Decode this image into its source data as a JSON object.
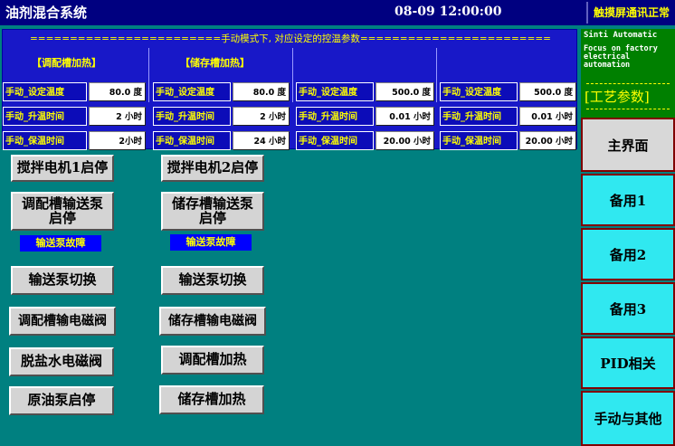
{
  "header": {
    "title": "油剂混合系统",
    "datetime": "08-09 12:00:00",
    "comm_status": "触摸屏通讯正常"
  },
  "params": {
    "banner": "========================手动模式下, 对应设定的控温参数========================",
    "groups": [
      {
        "title": "【调配槽加热】",
        "rows": [
          {
            "label": "手动_设定温度",
            "value": "80.0 度"
          },
          {
            "label": "手动_升温时间",
            "value": "2 小时"
          },
          {
            "label": "手动_保温时间",
            "value": "2小时"
          }
        ]
      },
      {
        "title": "【储存槽加热】",
        "rows": [
          {
            "label": "手动_设定温度",
            "value": "80.0 度"
          },
          {
            "label": "手动_升温时间",
            "value": "2 小时"
          },
          {
            "label": "手动_保温时间",
            "value": "24 小时"
          }
        ]
      },
      {
        "title": "",
        "rows": [
          {
            "label": "手动_设定温度",
            "value": "500.0 度"
          },
          {
            "label": "手动_升温时间",
            "value": "0.01 小时"
          },
          {
            "label": "手动_保温时间",
            "value": "20.00 小时"
          }
        ]
      },
      {
        "title": "",
        "rows": [
          {
            "label": "手动_设定温度",
            "value": "500.0 度"
          },
          {
            "label": "手动_升温时间",
            "value": "0.01 小时"
          },
          {
            "label": "手动_保温时间",
            "value": "20.00 小时"
          }
        ]
      }
    ]
  },
  "controls": {
    "col1": {
      "stirrer": "搅拌电机1启停",
      "pump": "调配槽输送泵启停",
      "fault": "输送泵故障",
      "switch": "输送泵切换",
      "valve": "调配槽输电磁阀",
      "water_valve": "脱盐水电磁阀",
      "oil_pump": "原油泵启停"
    },
    "col2": {
      "stirrer": "搅拌电机2启停",
      "pump": "储存槽输送泵启停",
      "fault": "输送泵故障",
      "switch": "输送泵切换",
      "valve": "储存槽输电磁阀",
      "mix_heat": "调配槽加热",
      "store_heat": "储存槽加热"
    }
  },
  "sidebar": {
    "brand": "Sinti Automatic",
    "slogan": "Focus on factory electrical automation",
    "process_params": "[工艺参数]",
    "nav": [
      "主界面",
      "备用1",
      "备用2",
      "备用3",
      "PID相关",
      "手动与其他"
    ]
  },
  "colors": {
    "background": "#008080",
    "topbar": "#000080",
    "panel": "#1818c8",
    "label_text": "#ffff00",
    "nav_cyan": "#30e8f0"
  }
}
